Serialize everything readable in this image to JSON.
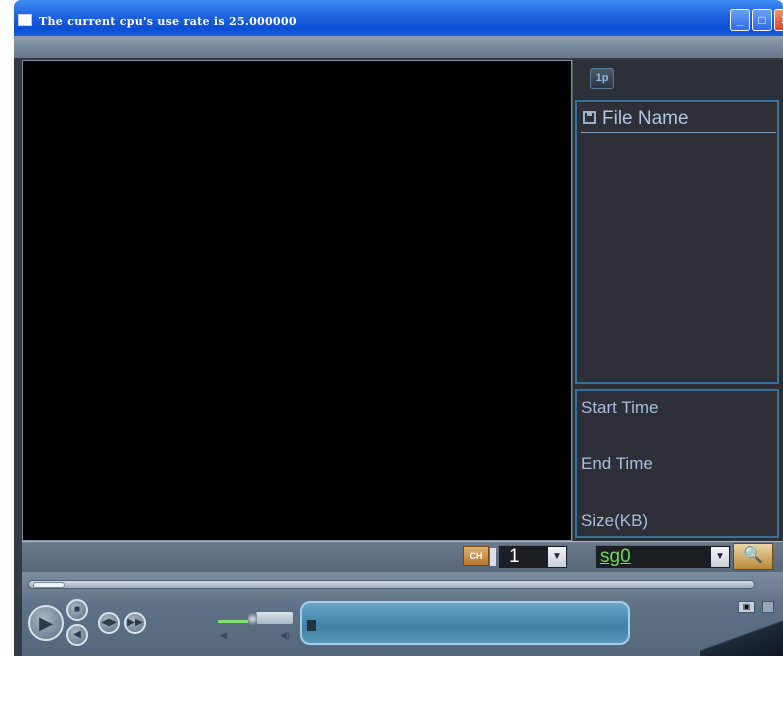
{
  "window": {
    "title": "The current cpu's use rate is 25.000000",
    "icons": {
      "minimize": "minimize-icon",
      "maximize": "maximize-icon",
      "close": "close-icon"
    },
    "min_glyph": "_",
    "max_glyph": "□",
    "close_glyph": "✕"
  },
  "right_panel": {
    "page_button": "1p",
    "file_list": {
      "header": "File Name",
      "icon": "floppy-disk-icon"
    },
    "info": {
      "start_time_label": "Start Time",
      "end_time_label": "End Time",
      "size_label": "Size(KB)"
    }
  },
  "channel_bar": {
    "ch_icon_label": "CH",
    "channel_value": "1",
    "disk_value": "sg0",
    "dropdown_glyph": "▼",
    "search_icon": "search-icon",
    "search_glyph": "🔍"
  },
  "player": {
    "seek_position": 0.0,
    "volume_level": 0.45,
    "play_glyph": "▶",
    "stop_glyph": "■",
    "back_glyph": "◀",
    "slow_glyph": "◀▶",
    "fast_glyph": "▶▶",
    "vol_low_glyph": "◀",
    "vol_high_glyph": "◀)",
    "snap_glyph": "▣"
  },
  "colors": {
    "titlebar": "#0a4fd4",
    "panel_border": "#3a6f9a",
    "label_text": "#a8bddc",
    "disk_text": "#6fdc52"
  }
}
